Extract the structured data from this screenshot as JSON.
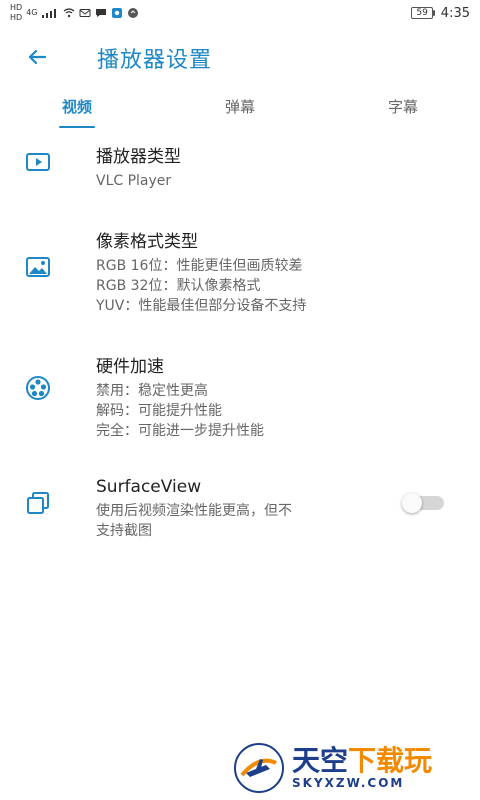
{
  "status_bar": {
    "left": {
      "label1": "HD",
      "label2": "HD",
      "network_label": "4G"
    },
    "battery": "59",
    "time": "4:35"
  },
  "header": {
    "title": "播放器设置"
  },
  "tabs": [
    {
      "label": "视频",
      "active": true
    },
    {
      "label": "弹幕",
      "active": false
    },
    {
      "label": "字幕",
      "active": false
    }
  ],
  "settings": {
    "items": [
      {
        "title": "播放器类型",
        "lines": [
          "VLC Player"
        ]
      },
      {
        "title": "像素格式类型",
        "lines": [
          "RGB 16位：性能更佳但画质较差",
          "RGB 32位：默认像素格式",
          "YUV：性能最佳但部分设备不支持"
        ]
      },
      {
        "title": "硬件加速",
        "lines": [
          "禁用：稳定性更高",
          "解码：可能提升性能",
          "完全：可能进一步提升性能"
        ]
      },
      {
        "title": "SurfaceView",
        "lines": [
          "使用后视频渲染性能更高，但不",
          "支持截图"
        ],
        "toggle": false
      }
    ]
  },
  "watermark": {
    "cn": "天空",
    "cn2": "下载玩",
    "en": "SKYXZW.COM"
  },
  "colors": {
    "accent": "#1e88c7"
  }
}
